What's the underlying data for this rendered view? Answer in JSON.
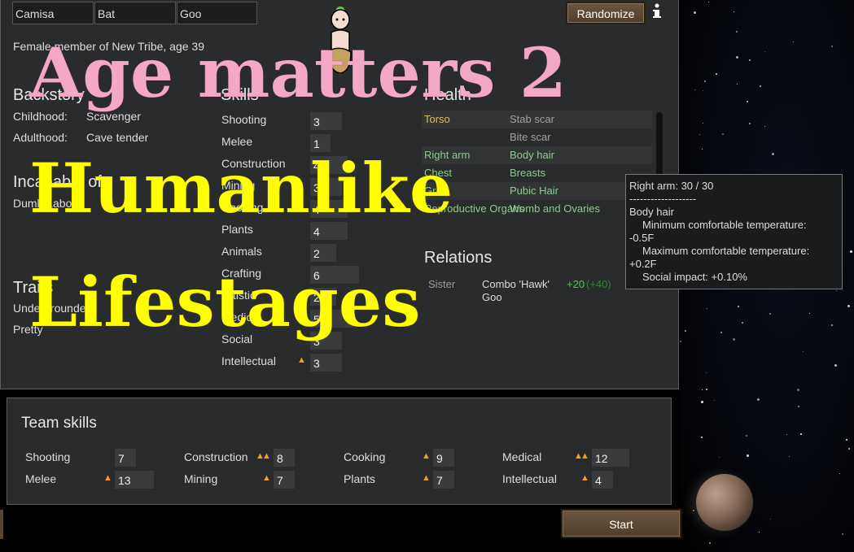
{
  "names": {
    "first": "Camisa",
    "nick": "Bat",
    "last": "Goo"
  },
  "randomize_label": "Randomize",
  "info_icon": "info-icon",
  "description": "Female member of New Tribe, age 39",
  "backstory": {
    "heading": "Backstory",
    "childhood_label": "Childhood:",
    "childhood_value": "Scavenger",
    "adulthood_label": "Adulthood:",
    "adulthood_value": "Cave tender"
  },
  "incapable": {
    "heading": "Incapable of",
    "value": "Dumb Labor"
  },
  "traits": {
    "heading": "Traits",
    "items": [
      "Undergrounder",
      "Pretty"
    ]
  },
  "skills": {
    "heading": "Skills",
    "items": [
      {
        "name": "Shooting",
        "value": "3",
        "passion": 0,
        "level": 0.15
      },
      {
        "name": "Melee",
        "value": "1",
        "passion": 0,
        "level": 0.05
      },
      {
        "name": "Construction",
        "value": "4",
        "passion": 0,
        "level": 0.2
      },
      {
        "name": "Mining",
        "value": "3",
        "passion": 0,
        "level": 0.15
      },
      {
        "name": "Cooking",
        "value": "4",
        "passion": 1,
        "level": 0.2
      },
      {
        "name": "Plants",
        "value": "4",
        "passion": 0,
        "level": 0.2
      },
      {
        "name": "Animals",
        "value": "2",
        "passion": 0,
        "level": 0.1
      },
      {
        "name": "Crafting",
        "value": "6",
        "passion": 0,
        "level": 0.3
      },
      {
        "name": "Artistic",
        "value": "2",
        "passion": 0,
        "level": 0.1
      },
      {
        "name": "Medical",
        "value": "5",
        "passion": 0,
        "level": 0.25
      },
      {
        "name": "Social",
        "value": "3",
        "passion": 0,
        "level": 0.15
      },
      {
        "name": "Intellectual",
        "value": "3",
        "passion": 1,
        "level": 0.15
      }
    ]
  },
  "health": {
    "heading": "Health",
    "rows": [
      {
        "part": "Torso",
        "condition": "Stab scar",
        "part_color": "#d8c060",
        "cond_color": "#a0a0a0"
      },
      {
        "part": "",
        "condition": "Bite scar",
        "part_color": "#d8c060",
        "cond_color": "#a0a0a0"
      },
      {
        "part": "Right arm",
        "condition": "Body hair",
        "part_color": "#8fc88f",
        "cond_color": "#8fc88f"
      },
      {
        "part": "Chest",
        "condition": "Breasts",
        "part_color": "#8fc88f",
        "cond_color": "#8fc88f"
      },
      {
        "part": "Groin",
        "condition": "Pubic Hair",
        "part_color": "#8fc88f",
        "cond_color": "#8fc88f"
      },
      {
        "part": "Reproductive Organs",
        "condition": "Womb and Ovaries",
        "part_color": "#8fc88f",
        "cond_color": "#8fc88f"
      }
    ]
  },
  "relations": {
    "heading": "Relations",
    "items": [
      {
        "relation": "Sister",
        "name": "Combo 'Hawk' Goo",
        "opinion": "+20",
        "opinion2": "(+40)"
      }
    ]
  },
  "tooltip": {
    "line1": "Right arm:  30 / 30",
    "line2": "-------------------",
    "line3": "Body hair",
    "line4": "Minimum comfortable temperature:",
    "line5": "-0.5F",
    "line6": "Maximum comfortable temperature:",
    "line7": "+0.2F",
    "line8": "Social impact: +0.10%"
  },
  "team_skills": {
    "heading": "Team skills",
    "items": [
      {
        "name": "Shooting",
        "value": "7",
        "passion": 0
      },
      {
        "name": "Construction",
        "value": "8",
        "passion": 2
      },
      {
        "name": "Cooking",
        "value": "9",
        "passion": 1
      },
      {
        "name": "Medical",
        "value": "12",
        "passion": 2
      },
      {
        "name": "Melee",
        "value": "13",
        "passion": 1
      },
      {
        "name": "Mining",
        "value": "7",
        "passion": 1
      },
      {
        "name": "Plants",
        "value": "7",
        "passion": 1
      },
      {
        "name": "Intellectual",
        "value": "4",
        "passion": 1
      }
    ]
  },
  "start_label": "Start",
  "overlay": {
    "line1": "Age matters 2",
    "line2": "Humanlike",
    "line3": "Lifestages",
    "color1": "#f4a8c8",
    "color2": "#ffff00"
  }
}
